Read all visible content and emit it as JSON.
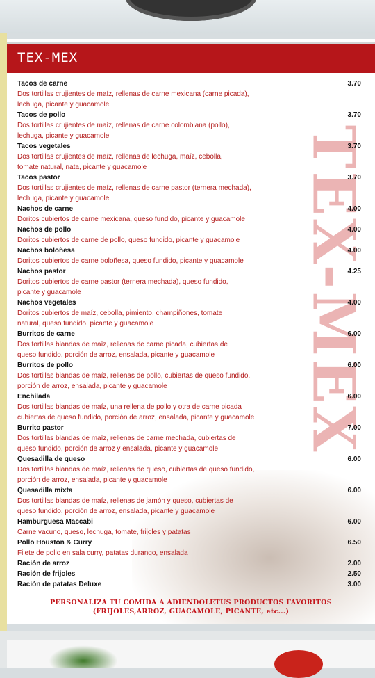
{
  "header": {
    "title": "TEX-MEX"
  },
  "watermark": "TEX-MEX",
  "items": [
    {
      "name": "Tacos de carne",
      "price": "3.70",
      "desc": [
        "Dos tortillas crujientes de maíz, rellenas de carne mexicana (carne picada),",
        "lechuga, picante y guacamole"
      ]
    },
    {
      "name": "Tacos de pollo",
      "price": "3.70",
      "desc": [
        "Dos tortillas crujientes de maíz, rellenas de carne colombiana (pollo),",
        "lechuga, picante y guacamole"
      ]
    },
    {
      "name": "Tacos vegetales",
      "price": "3.70",
      "desc": [
        "Dos tortillas crujientes de maíz, rellenas de lechuga, maíz, cebolla,",
        "tomate natural, nata, picante y guacamole"
      ]
    },
    {
      "name": "Tacos pastor",
      "price": "3.70",
      "desc": [
        "Dos tortillas crujientes de maíz, rellenas de carne pastor (ternera mechada),",
        "lechuga, picante y guacamole"
      ]
    },
    {
      "name": "Nachos de carne",
      "price": "4.00",
      "desc": [
        "Doritos cubiertos de carne mexicana, queso fundido, picante y guacamole"
      ]
    },
    {
      "name": "Nachos de pollo",
      "price": "4.00",
      "desc": [
        "Doritos cubiertos de carne de pollo, queso fundido, picante y guacamole"
      ]
    },
    {
      "name": "Nachos boloñesa",
      "price": "4.00",
      "desc": [
        "Doritos cubiertos de carne boloñesa, queso fundido, picante y guacamole"
      ]
    },
    {
      "name": "Nachos pastor",
      "price": "4.25",
      "desc": [
        "Doritos cubiertos de carne pastor (ternera mechada), queso fundido,",
        "picante y guacamole"
      ]
    },
    {
      "name": "Nachos vegetales",
      "price": "4.00",
      "desc": [
        "Doritos cubiertos de maíz, cebolla, pimiento, champiñones, tomate",
        "natural, queso fundido, picante y guacamole"
      ]
    },
    {
      "name": "Burritos de carne",
      "price": "6.00",
      "desc": [
        "Dos tortillas blandas de maíz, rellenas de carne picada, cubiertas de",
        "queso fundido, porción de arroz, ensalada, picante y guacamole"
      ]
    },
    {
      "name": "Burritos de pollo",
      "price": "6.00",
      "desc": [
        "Dos tortillas blandas de maíz, rellenas de pollo, cubiertas de queso fundido,",
        "porción de arroz, ensalada, picante y guacamole"
      ]
    },
    {
      "name": "Enchilada",
      "price": "6.00",
      "desc": [
        "Dos tortillas blandas de maíz, una rellena de pollo y otra de carne picada",
        "cubiertas de queso fundido, porción de arroz, ensalada, picante y guacamole"
      ]
    },
    {
      "name": "Burrito pastor",
      "price": "7.00",
      "desc": [
        "Dos tortillas blandas de maíz, rellenas de carne mechada, cubiertas de",
        "queso fundido, porción de arroz y ensalada, picante y guacamole"
      ]
    },
    {
      "name": "Quesadilla de queso",
      "price": "6.00",
      "desc": [
        "Dos tortillas blandas de maíz, rellenas de queso, cubiertas de queso fundido,",
        "porción de arroz, ensalada, picante y guacamole"
      ]
    },
    {
      "name": "Quesadilla mixta",
      "price": "6.00",
      "desc": [
        "Dos tortillas blandas de maíz, rellenas de jamón y queso, cubiertas de",
        "queso fundido, porción de arroz, ensalada, picante y guacamole"
      ]
    },
    {
      "name": "Hamburguesa Maccabi",
      "price": "6.00",
      "desc": [
        "Carne vacuno, queso, lechuga, tomate, frijoles y patatas"
      ]
    },
    {
      "name": "Pollo Houston & Curry",
      "price": "6.50",
      "desc": [
        "Filete de pollo en sala curry, patatas durango, ensalada"
      ]
    },
    {
      "name": "Ración de arroz",
      "price": "2.00",
      "desc": []
    },
    {
      "name": "Ración de frijoles",
      "price": "2.50",
      "desc": []
    },
    {
      "name": "Ración de patatas Deluxe",
      "price": "3.00",
      "desc": []
    }
  ],
  "footer": {
    "line1": "PERSONALIZA TU COMIDA A ADIENDOLETUS PRODUCTOS FAVORITOS",
    "line2": "(FRIJOLES,ARROZ, GUACAMOLE, PICANTE, etc...)"
  },
  "colors": {
    "header": "#b6161a",
    "desc_text": "#b31c1c",
    "watermark": "#e8a8a8"
  }
}
